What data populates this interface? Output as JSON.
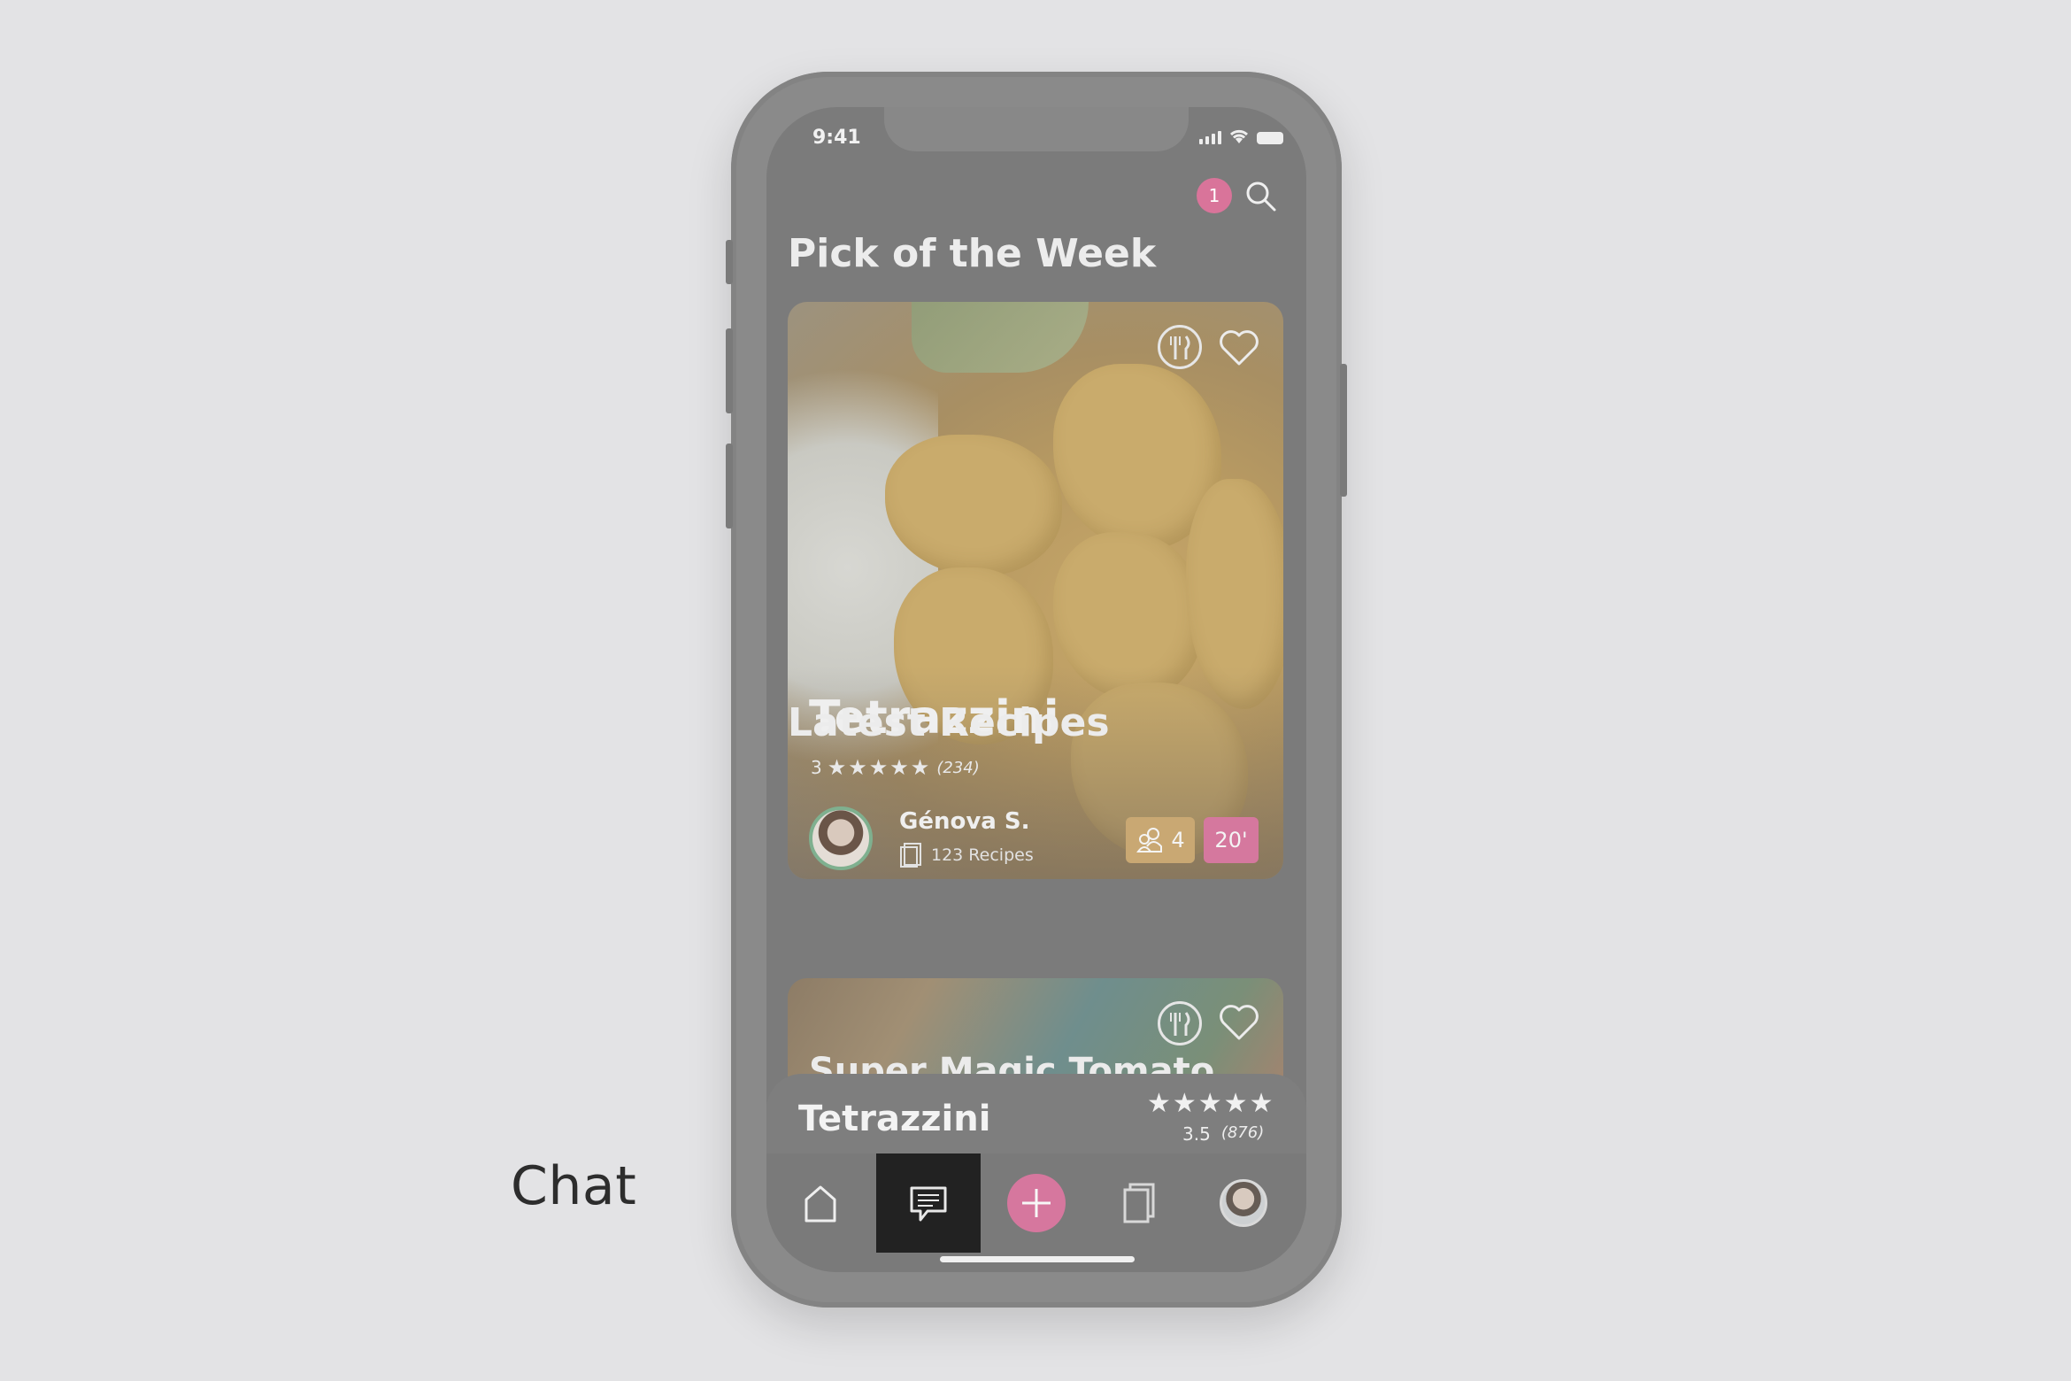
{
  "annotation": {
    "label": "Chat"
  },
  "status_bar": {
    "time": "9:41"
  },
  "header": {
    "notification_count": "1"
  },
  "sections": {
    "pick_title": "Pick of the Week",
    "latest_title": "Latest Recipes"
  },
  "hero": {
    "title": "Tetrazzini",
    "rating_value": "3",
    "stars": "★★★★★",
    "review_count": "(234)",
    "author_name": "Génova S.",
    "author_recipes": "123 Recipes",
    "servings": "4",
    "time": "20'"
  },
  "latest": {
    "first_title": "Super Magic Tomato"
  },
  "mini_player": {
    "title": "Tetrazzini",
    "stars": "★★★★★",
    "rating_value": "3.5",
    "review_count": "(876)"
  },
  "tabs": [
    {
      "name": "home-icon"
    },
    {
      "name": "chat-icon",
      "active": true
    },
    {
      "name": "add-icon"
    },
    {
      "name": "recipes-icon"
    },
    {
      "name": "profile-avatar"
    }
  ],
  "colors": {
    "accent_pink": "#d6779e",
    "accent_gold": "#c9a873",
    "verified_green": "#7fb08f"
  }
}
